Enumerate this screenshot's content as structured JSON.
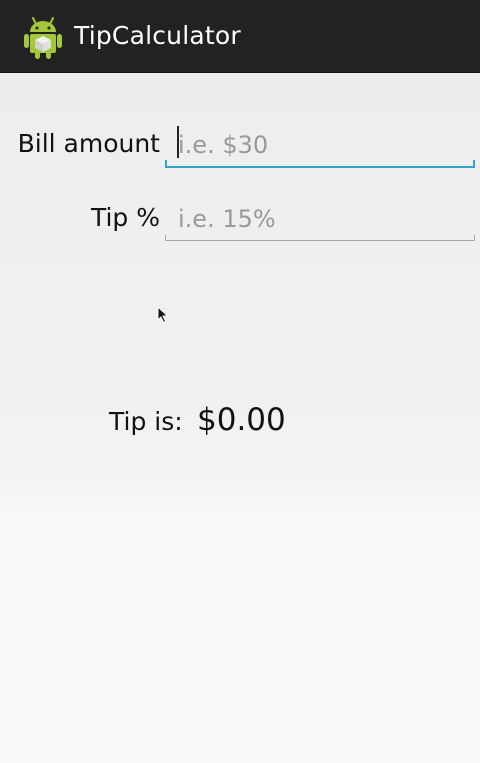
{
  "action_bar": {
    "title": "TipCalculator",
    "icon": "android-icon",
    "background": "#222222"
  },
  "form": {
    "bill": {
      "label": "Bill amount",
      "placeholder": "i.e. $30",
      "value": "",
      "focused": true
    },
    "tip": {
      "label": "Tip %",
      "placeholder": "i.e. 15%",
      "value": ""
    }
  },
  "result": {
    "label": "Tip is:",
    "value": "$0.00"
  },
  "colors": {
    "accent": "#33a2c9",
    "placeholder": "#9a9a9a"
  }
}
